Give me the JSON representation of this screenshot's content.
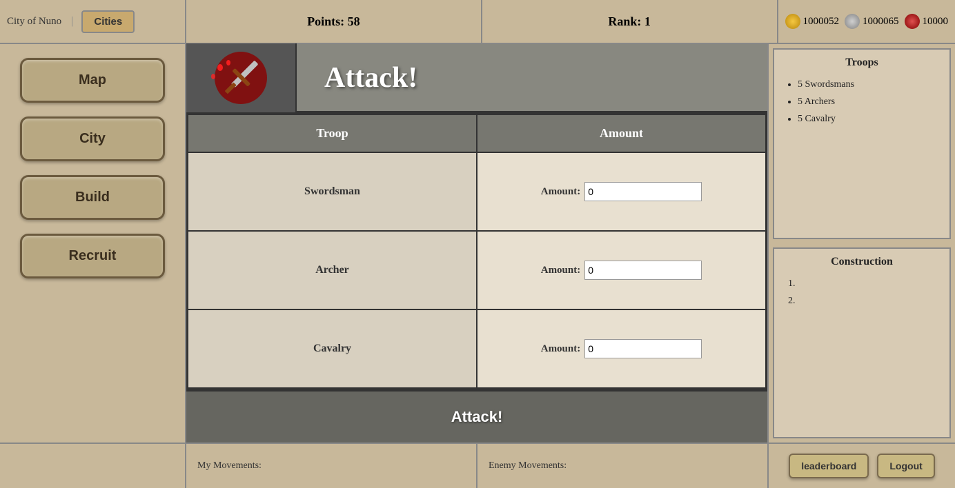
{
  "header": {
    "city_name": "City of Nuno",
    "cities_btn": "Cities",
    "divider": "|",
    "points_label": "Points: 58",
    "rank_label": "Rank: 1",
    "resources": [
      {
        "icon": "gold-icon",
        "value": "1000052"
      },
      {
        "icon": "silver-icon",
        "value": "1000065"
      },
      {
        "icon": "food-icon",
        "value": "10000"
      }
    ]
  },
  "sidebar": {
    "items": [
      {
        "label": "Map",
        "name": "map-nav"
      },
      {
        "label": "City",
        "name": "city-nav"
      },
      {
        "label": "Build",
        "name": "build-nav"
      },
      {
        "label": "Recruit",
        "name": "recruit-nav"
      }
    ]
  },
  "attack_panel": {
    "title": "Attack!",
    "table": {
      "col_troop": "Troop",
      "col_amount": "Amount",
      "rows": [
        {
          "troop": "Swordsman",
          "amount_label": "Amount:",
          "amount_value": "0",
          "name": "swordsman"
        },
        {
          "troop": "Archer",
          "amount_label": "Amount:",
          "amount_value": "0",
          "name": "archer"
        },
        {
          "troop": "Cavalry",
          "amount_label": "Amount:",
          "amount_value": "0",
          "name": "cavalry"
        }
      ]
    },
    "attack_btn": "Attack!"
  },
  "right_panel": {
    "troops": {
      "title": "Troops",
      "items": [
        "5 Swordsmans",
        "5 Archers",
        "5 Cavalry"
      ]
    },
    "construction": {
      "title": "Construction",
      "items": [
        "",
        ""
      ]
    }
  },
  "bottom": {
    "my_movements": "My Movements:",
    "enemy_movements": "Enemy Movements:",
    "leaderboard_btn": "leaderboard",
    "logout_btn": "Logout"
  }
}
